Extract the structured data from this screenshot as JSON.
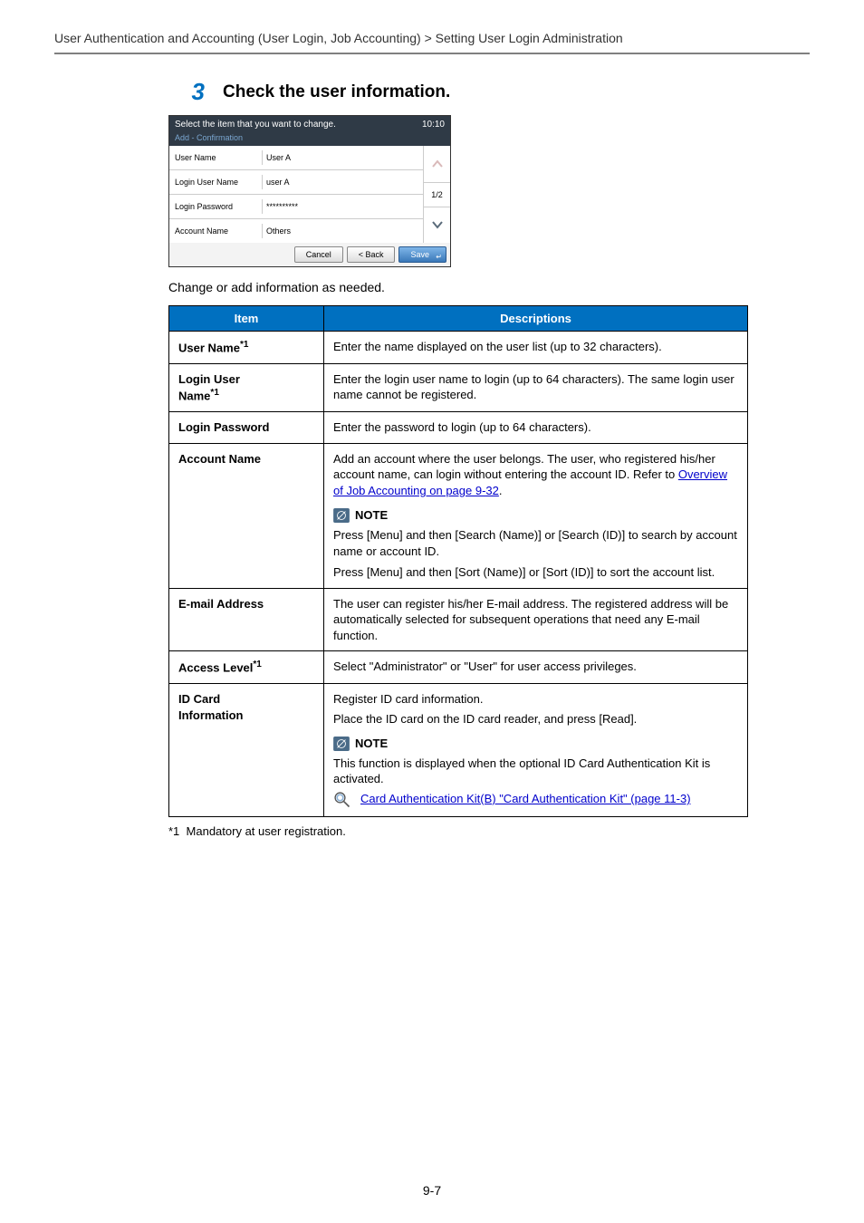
{
  "breadcrumb": "User Authentication and Accounting (User Login, Job Accounting) > Setting User Login Administration",
  "step": {
    "number": "3",
    "title": "Check the user information."
  },
  "device": {
    "header": "Select the item that you want to change.",
    "time": "10:10",
    "subtitle": "Add - Confirmation",
    "rows": [
      {
        "label": "User Name",
        "value": "User A"
      },
      {
        "label": "Login User Name",
        "value": "user A"
      },
      {
        "label": "Login Password",
        "value": "**********"
      },
      {
        "label": "Account Name",
        "value": "Others"
      }
    ],
    "page_indicator": "1/2",
    "buttons": {
      "cancel": "Cancel",
      "back": "< Back",
      "save": "Save"
    }
  },
  "caption": "Change or add information as needed.",
  "table": {
    "headers": {
      "item": "Item",
      "desc": "Descriptions"
    },
    "rows": {
      "user_name": {
        "label": "User Name",
        "sup": "*1",
        "desc": "Enter the name displayed on the user list (up to 32 characters)."
      },
      "login_user": {
        "label1": "Login User",
        "label2": "Name",
        "sup": "*1",
        "desc": "Enter the login user name to login (up to 64 characters). The same login user name cannot be registered."
      },
      "login_pw": {
        "label": "Login Password",
        "desc": "Enter the password to login (up to 64 characters)."
      },
      "account": {
        "label": "Account Name",
        "desc_pre": "Add an account where the user belongs. The user, who registered his/her account name, can login without entering the account ID. Refer to ",
        "link": "Overview of Job Accounting on page 9-32",
        "desc_post": ".",
        "note_label": "NOTE",
        "note1": "Press [Menu] and then [Search (Name)] or [Search (ID)] to search by account name or account ID.",
        "note2": "Press [Menu] and then [Sort (Name)] or [Sort (ID)] to sort the account list."
      },
      "email": {
        "label": "E-mail Address",
        "desc": "The user can register his/her E-mail address. The registered address will be automatically selected for subsequent operations that need any E-mail function."
      },
      "access": {
        "label": "Access Level",
        "sup": "*1",
        "desc": "Select \"Administrator\" or \"User\" for user access privileges."
      },
      "idcard": {
        "label1": "ID Card",
        "label2": "Information",
        "line1": "Register ID card information.",
        "line2": "Place the ID card on the ID card reader, and press [Read].",
        "note_label": "NOTE",
        "note_text": "This function is displayed when the optional ID Card Authentication Kit is activated.",
        "ref_link": "Card Authentication Kit(B) \"Card Authentication Kit\" (page 11-3)"
      }
    }
  },
  "footnote": {
    "marker": "*1",
    "text": "Mandatory at user registration."
  },
  "page_number": "9-7"
}
